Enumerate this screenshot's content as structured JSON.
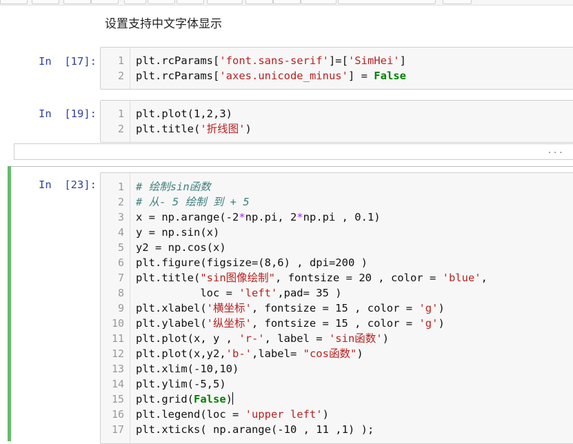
{
  "markdown_text": "设置支持中文字体显示",
  "cells": [
    {
      "prompt": "In  [17]:",
      "lines": [
        {
          "n": "1",
          "code": [
            [
              "",
              "plt.rcParams["
            ],
            [
              "st",
              "'font.sans-serif'"
            ],
            [
              "",
              "]=["
            ],
            [
              "st",
              "'SimHei'"
            ],
            [
              "",
              "]"
            ]
          ]
        },
        {
          "n": "2",
          "code": [
            [
              "",
              "plt.rcParams["
            ],
            [
              "st",
              "'axes.unicode_minus'"
            ],
            [
              "",
              "] = "
            ],
            [
              "kw",
              "False"
            ]
          ]
        }
      ]
    },
    {
      "prompt": "In  [19]:",
      "lines": [
        {
          "n": "1",
          "code": [
            [
              "",
              "plt.plot(1,2,3)"
            ]
          ]
        },
        {
          "n": "2",
          "code": [
            [
              "",
              "plt.title("
            ],
            [
              "st",
              "'折线图'"
            ],
            [
              "",
              ")"
            ]
          ]
        }
      ]
    },
    {
      "prompt": "In  [23]:",
      "lines": [
        {
          "n": "1",
          "code": [
            [
              "cm",
              "# 绘制sin函数"
            ]
          ]
        },
        {
          "n": "2",
          "code": [
            [
              "cm",
              "# 从- 5 绘制 到 + 5"
            ]
          ]
        },
        {
          "n": "3",
          "code": [
            [
              "",
              "x = np.arange(-2"
            ],
            [
              "op",
              "*"
            ],
            [
              "",
              ""
            ],
            [
              "",
              "np.pi, 2"
            ],
            [
              "op",
              "*"
            ],
            [
              "",
              ""
            ],
            [
              "",
              "np.pi , 0.1)"
            ]
          ]
        },
        {
          "n": "4",
          "code": [
            [
              "",
              "y = np.sin(x)"
            ]
          ]
        },
        {
          "n": "5",
          "code": [
            [
              "",
              "y2 = np.cos(x)"
            ]
          ]
        },
        {
          "n": "6",
          "code": [
            [
              "",
              "plt.figure(figsize=(8,6) , dpi=200 )"
            ]
          ]
        },
        {
          "n": "7",
          "code": [
            [
              "",
              "plt.title("
            ],
            [
              "st",
              "\"sin图像绘制\""
            ],
            [
              "",
              ", fontsize = 20 , color = "
            ],
            [
              "st",
              "'blue'"
            ],
            [
              "",
              ","
            ]
          ]
        },
        {
          "n": "8",
          "code": [
            [
              "",
              "          loc = "
            ],
            [
              "st",
              "'left'"
            ],
            [
              "",
              ",pad= 35 )"
            ]
          ]
        },
        {
          "n": "9",
          "code": [
            [
              "",
              "plt.xlabel("
            ],
            [
              "st",
              "'横坐标'"
            ],
            [
              "",
              ", fontsize = 15 , color = "
            ],
            [
              "st",
              "'g'"
            ],
            [
              "",
              ")"
            ]
          ]
        },
        {
          "n": "10",
          "code": [
            [
              "",
              "plt.ylabel("
            ],
            [
              "st",
              "'纵坐标'"
            ],
            [
              "",
              ", fontsize = 15 , color = "
            ],
            [
              "st",
              "'g'"
            ],
            [
              "",
              ")"
            ]
          ]
        },
        {
          "n": "11",
          "code": [
            [
              "",
              "plt.plot(x, y , "
            ],
            [
              "st",
              "'r-'"
            ],
            [
              "",
              ", label = "
            ],
            [
              "st",
              "'sin函数'"
            ],
            [
              "",
              ")"
            ]
          ]
        },
        {
          "n": "12",
          "code": [
            [
              "",
              "plt.plot(x,y2,"
            ],
            [
              "st",
              "'b-'"
            ],
            [
              "",
              ",label= "
            ],
            [
              "st",
              "\"cos函数\""
            ],
            [
              "",
              ")"
            ]
          ]
        },
        {
          "n": "13",
          "code": [
            [
              "",
              "plt.xlim(-10,10)"
            ]
          ]
        },
        {
          "n": "14",
          "code": [
            [
              "",
              "plt.ylim(-5,5)"
            ]
          ]
        },
        {
          "n": "15",
          "code": [
            [
              "",
              "plt.grid("
            ],
            [
              "kw",
              "False"
            ],
            [
              "",
              ")"
            ]
          ]
        },
        {
          "n": "16",
          "code": [
            [
              "",
              "plt.legend(loc = "
            ],
            [
              "st",
              "'upper left'"
            ],
            [
              "",
              ")"
            ]
          ]
        },
        {
          "n": "17",
          "code": [
            [
              "",
              "plt.xticks( np.arange(-10 , 11 ,1) );"
            ]
          ]
        }
      ]
    }
  ],
  "collapsed_output": "...",
  "colors": {
    "prompt": "#303f9f",
    "string": "#ba2121",
    "keyword": "#008000",
    "comment": "#408080",
    "selected_bar": "#66bb6a"
  }
}
